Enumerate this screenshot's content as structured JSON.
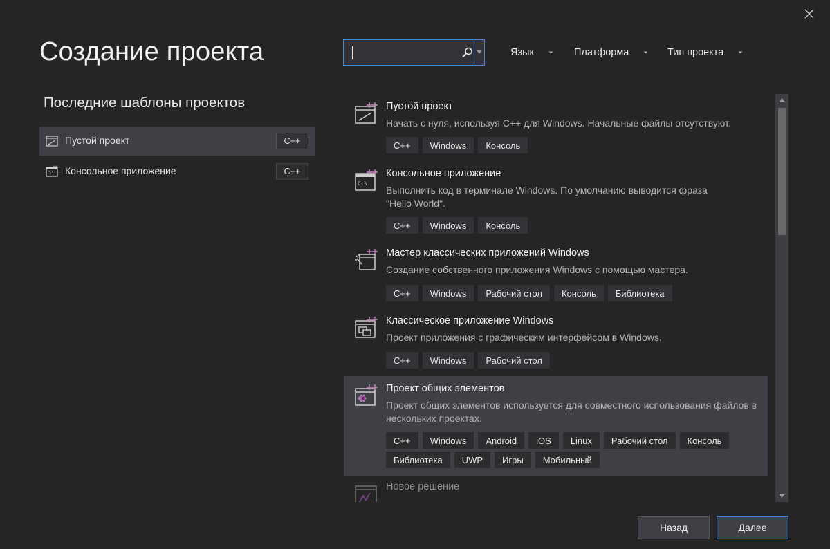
{
  "header": {
    "title": "Создание проекта",
    "search": {
      "value": "",
      "placeholder": ""
    },
    "filters": [
      {
        "label": "Язык"
      },
      {
        "label": "Платформа"
      },
      {
        "label": "Тип проекта"
      }
    ]
  },
  "recent": {
    "title": "Последние шаблоны проектов",
    "items": [
      {
        "label": "Пустой проект",
        "tag": "C++",
        "icon": "empty-project-icon",
        "selected": true
      },
      {
        "label": "Консольное приложение",
        "tag": "C++",
        "icon": "console-app-icon",
        "selected": false
      }
    ]
  },
  "templates": [
    {
      "title": "Пустой проект",
      "description": "Начать с нуля, используя C++ для Windows. Начальные файлы отсутствуют.",
      "tags": [
        "C++",
        "Windows",
        "Консоль"
      ],
      "icon": "empty-project-icon"
    },
    {
      "title": "Консольное приложение",
      "description": "Выполнить код в терминале Windows. По умолчанию выводится фраза \"Hello World\".",
      "tags": [
        "C++",
        "Windows",
        "Консоль"
      ],
      "icon": "console-app-icon"
    },
    {
      "title": "Мастер классических приложений Windows",
      "description": "Создание собственного приложения Windows с помощью мастера.",
      "tags": [
        "C++",
        "Windows",
        "Рабочий стол",
        "Консоль",
        "Библиотека"
      ],
      "icon": "desktop-wizard-icon"
    },
    {
      "title": "Классическое приложение Windows",
      "description": "Проект приложения с графическим интерфейсом в Windows.",
      "tags": [
        "C++",
        "Windows",
        "Рабочий стол"
      ],
      "icon": "desktop-app-icon"
    },
    {
      "title": "Проект общих элементов",
      "description": "Проект общих элементов используется для совместного использования файлов в нескольких проектах.",
      "tags": [
        "C++",
        "Windows",
        "Android",
        "iOS",
        "Linux",
        "Рабочий стол",
        "Консоль",
        "Библиотека",
        "UWP",
        "Игры",
        "Мобильный"
      ],
      "icon": "shared-items-icon",
      "selected": true
    },
    {
      "title": "Новое решение",
      "description": "",
      "tags": [],
      "icon": "new-solution-icon",
      "faded": true
    }
  ],
  "footer": {
    "back_label": "Назад",
    "next_label": "Далее"
  },
  "colors": {
    "background": "#252526",
    "selected": "#3f3f46",
    "accent": "#3e8bd8",
    "template_plus": "#c586c0"
  }
}
